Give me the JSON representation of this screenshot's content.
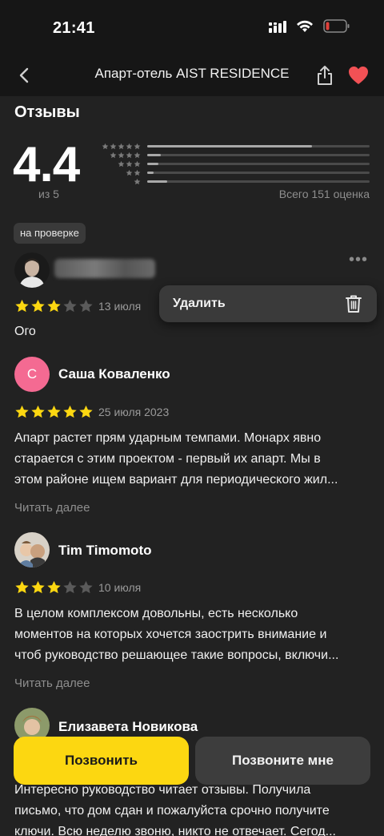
{
  "status_bar": {
    "time": "21:41",
    "icons": [
      "signal-icon",
      "wifi-icon",
      "battery-icon"
    ],
    "battery_color": "#e0413b"
  },
  "nav": {
    "title": "Апарт-отель AIST RESIDENCE",
    "back_icon": "chevron-left-icon",
    "share_icon": "share-icon",
    "favorite_icon": "heart-icon",
    "favorite_color": "#f25155"
  },
  "reviews_section": {
    "title": "Отзывы",
    "rating": "4.4",
    "rating_of": "из 5",
    "total": "Всего 151 оценка",
    "distribution": [
      {
        "stars": 5,
        "fraction": 0.74
      },
      {
        "stars": 4,
        "fraction": 0.06
      },
      {
        "stars": 3,
        "fraction": 0.05
      },
      {
        "stars": 2,
        "fraction": 0.03
      },
      {
        "stars": 1,
        "fraction": 0.09
      }
    ]
  },
  "my_review": {
    "badge": "на проверке",
    "rating": 3,
    "date": "13 июля",
    "text": "Ого",
    "menu_icon": "more-horizontal-icon",
    "popup": {
      "label": "Удалить",
      "icon": "trash-icon"
    }
  },
  "reviews": [
    {
      "author": "Саша Коваленко",
      "avatar_letter": "С",
      "avatar_color": "#f46a92",
      "rating": 5,
      "date": "25 июля 2023",
      "text_lines": [
        "Апарт растет прям ударным темпами. Монарх явно",
        "старается с этим проектом - первый их апарт. Мы в",
        "этом районе ищем вариант для периодического жил..."
      ],
      "read_more": "Читать далее"
    },
    {
      "author": "Tim Timomoto",
      "rating": 3,
      "date": "10 июля",
      "text_lines": [
        "В целом комплексом довольны, есть несколько",
        "моментов на которых хочется заострить внимание и",
        "чтоб руководство решающее такие вопросы, включи..."
      ],
      "read_more": "Читать далее"
    },
    {
      "author": "Елизавета Новикова",
      "text_lines": [
        "Интересно руководство читает отзывы. Получила",
        "письмо, что дом сдан и пожалуйста срочно получите",
        "ключи. Всю неделю звоню, никто не отвечает. Сегод..."
      ]
    }
  ],
  "actions": {
    "call": "Позвонить",
    "callback": "Позвоните мне"
  },
  "colors": {
    "star_active": "#fcd711",
    "star_inactive": "#5a5a5a",
    "background": "#222222"
  }
}
